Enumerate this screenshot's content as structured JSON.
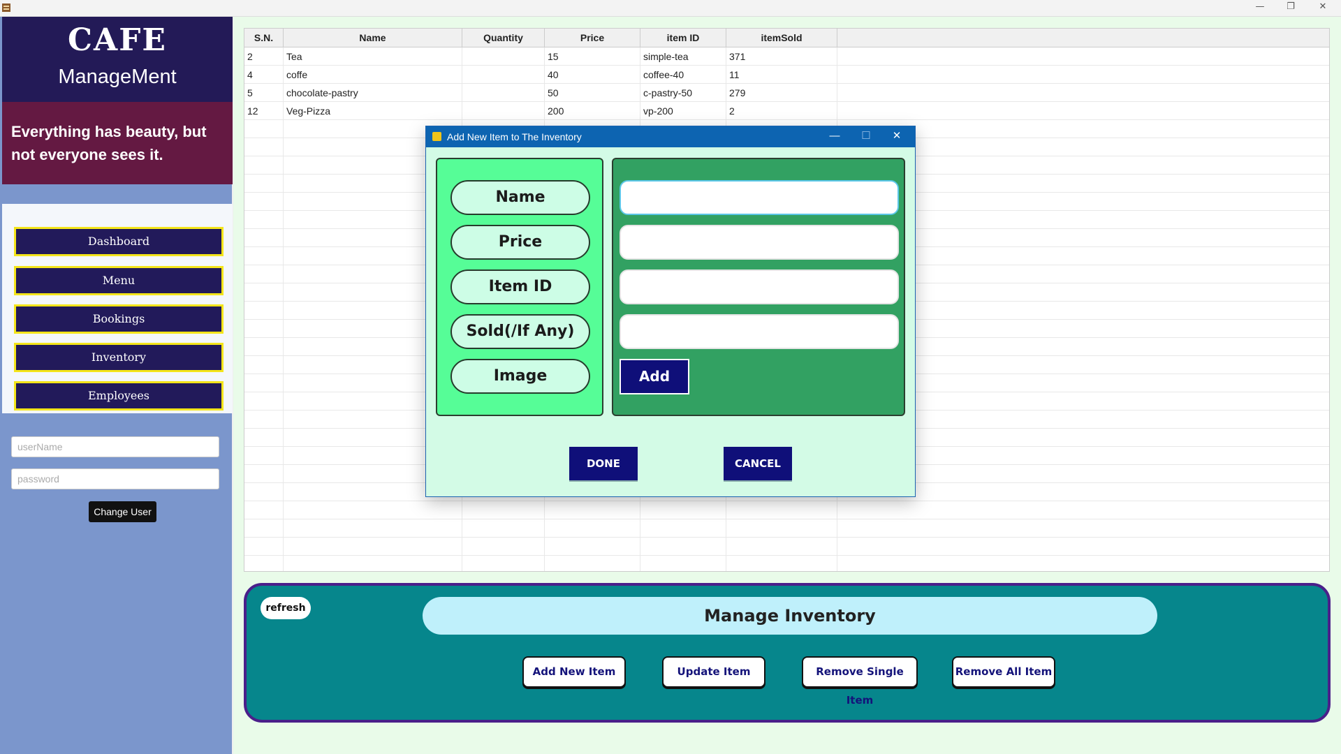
{
  "window": {
    "minimize": "—",
    "restore": "❐",
    "close": "✕"
  },
  "sidebar": {
    "brand_title": "CAFE",
    "brand_subtitle": "ManageMent",
    "quote": "Everything has beauty, but not everyone sees it.",
    "nav": [
      "Dashboard",
      "Menu",
      "Bookings",
      "Inventory",
      "Employees"
    ],
    "username_placeholder": "userName",
    "password_placeholder": "password",
    "change_user": "Change User"
  },
  "table": {
    "columns": [
      "S.N.",
      "Name",
      "Quantity",
      "Price",
      "item ID",
      "itemSold"
    ],
    "rows": [
      [
        "2",
        "Tea",
        "",
        "15",
        "simple-tea",
        "371"
      ],
      [
        "4",
        "coffe",
        "",
        "40",
        "coffee-40",
        "11"
      ],
      [
        "5",
        "chocolate-pastry",
        "",
        "50",
        "c-pastry-50",
        "279"
      ],
      [
        "12",
        "Veg-Pizza",
        "",
        "200",
        "vp-200",
        "2"
      ]
    ]
  },
  "manage": {
    "refresh": "refresh",
    "title": "Manage Inventory",
    "actions": [
      "Add New Item",
      "Update Item",
      "Remove Single Item",
      "Remove All Item"
    ]
  },
  "dialog": {
    "title": "Add New Item to The Inventory",
    "labels": [
      "Name",
      "Price",
      "Item ID",
      "Sold(/If Any)",
      "Image"
    ],
    "inputs": [
      "",
      "",
      "",
      ""
    ],
    "add": "Add",
    "done": "DONE",
    "cancel": "CANCEL",
    "controls": {
      "minimize": "—",
      "maximize": "☐",
      "close": "✕"
    }
  },
  "colors": {
    "brand_bg": "#231a57",
    "quote_bg": "#641942",
    "sidebar_bg": "#7b96cc",
    "nav_border": "#f4e51a",
    "manage_bg": "#06868c",
    "dialog_bg": "#d3fbe6",
    "label_panel": "#56fd97",
    "input_panel": "#32a162",
    "button_navy": "#0f0f79"
  }
}
